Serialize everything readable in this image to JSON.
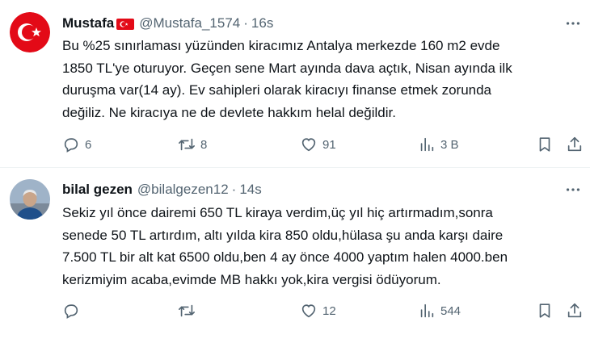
{
  "tweets": [
    {
      "name": "Mustafa",
      "handle": "@Mustafa_1574",
      "separator": "·",
      "time": "16s",
      "text": "Bu %25 sınırlaması yüzünden kiracımız Antalya merkezde 160 m2 evde\n1850 TL'ye oturuyor. Geçen sene Mart ayında dava açtık, Nisan ayında ilk\nduruşma var(14 ay). Ev sahipleri olarak kiracıyı finanse etmek zorunda\ndeğiliz. Ne kiracıya ne de devlete hakkım helal değildir.",
      "replies": "6",
      "retweets": "8",
      "likes": "91",
      "views": "3 B",
      "flag_icon": "turkey-flag-icon"
    },
    {
      "name": "bilal gezen",
      "handle": "@bilalgezen12",
      "separator": "·",
      "time": "14s",
      "text": "Sekiz yıl önce dairemi 650 TL kiraya verdim,üç yıl hiç artırmadım,sonra\nsenede 50 TL artırdım, altı yılda kira 850 oldu,hülasa şu anda karşı daire\n7.500 TL bir alt kat 6500 oldu,ben 4 ay önce 4000 yaptım halen 4000.ben\nkerizmiyim acaba,evimde MB hakkı yok,kira vergisi ödüyorum.",
      "replies": "",
      "retweets": "",
      "likes": "12",
      "views": "544"
    }
  ],
  "colors": {
    "text": "#0f1419",
    "secondary": "#536471",
    "divider": "#eff3f4",
    "flag_red": "#e30a17"
  }
}
